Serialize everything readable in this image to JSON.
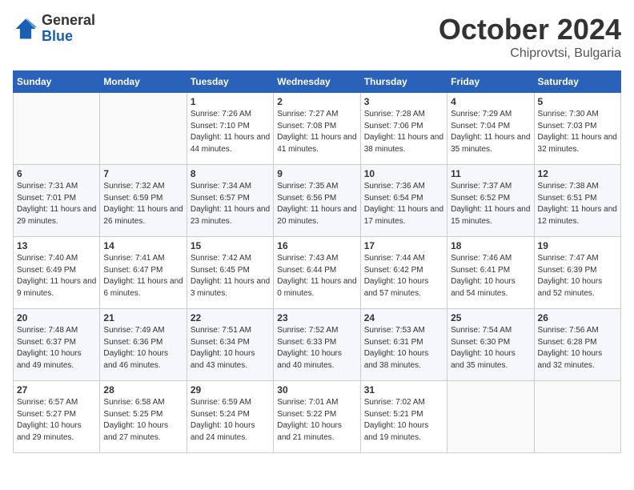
{
  "logo": {
    "general": "General",
    "blue": "Blue"
  },
  "header": {
    "month": "October 2024",
    "location": "Chiprovtsi, Bulgaria"
  },
  "weekdays": [
    "Sunday",
    "Monday",
    "Tuesday",
    "Wednesday",
    "Thursday",
    "Friday",
    "Saturday"
  ],
  "weeks": [
    [
      {
        "day": "",
        "info": ""
      },
      {
        "day": "",
        "info": ""
      },
      {
        "day": "1",
        "info": "Sunrise: 7:26 AM\nSunset: 7:10 PM\nDaylight: 11 hours and 44 minutes."
      },
      {
        "day": "2",
        "info": "Sunrise: 7:27 AM\nSunset: 7:08 PM\nDaylight: 11 hours and 41 minutes."
      },
      {
        "day": "3",
        "info": "Sunrise: 7:28 AM\nSunset: 7:06 PM\nDaylight: 11 hours and 38 minutes."
      },
      {
        "day": "4",
        "info": "Sunrise: 7:29 AM\nSunset: 7:04 PM\nDaylight: 11 hours and 35 minutes."
      },
      {
        "day": "5",
        "info": "Sunrise: 7:30 AM\nSunset: 7:03 PM\nDaylight: 11 hours and 32 minutes."
      }
    ],
    [
      {
        "day": "6",
        "info": "Sunrise: 7:31 AM\nSunset: 7:01 PM\nDaylight: 11 hours and 29 minutes."
      },
      {
        "day": "7",
        "info": "Sunrise: 7:32 AM\nSunset: 6:59 PM\nDaylight: 11 hours and 26 minutes."
      },
      {
        "day": "8",
        "info": "Sunrise: 7:34 AM\nSunset: 6:57 PM\nDaylight: 11 hours and 23 minutes."
      },
      {
        "day": "9",
        "info": "Sunrise: 7:35 AM\nSunset: 6:56 PM\nDaylight: 11 hours and 20 minutes."
      },
      {
        "day": "10",
        "info": "Sunrise: 7:36 AM\nSunset: 6:54 PM\nDaylight: 11 hours and 17 minutes."
      },
      {
        "day": "11",
        "info": "Sunrise: 7:37 AM\nSunset: 6:52 PM\nDaylight: 11 hours and 15 minutes."
      },
      {
        "day": "12",
        "info": "Sunrise: 7:38 AM\nSunset: 6:51 PM\nDaylight: 11 hours and 12 minutes."
      }
    ],
    [
      {
        "day": "13",
        "info": "Sunrise: 7:40 AM\nSunset: 6:49 PM\nDaylight: 11 hours and 9 minutes."
      },
      {
        "day": "14",
        "info": "Sunrise: 7:41 AM\nSunset: 6:47 PM\nDaylight: 11 hours and 6 minutes."
      },
      {
        "day": "15",
        "info": "Sunrise: 7:42 AM\nSunset: 6:45 PM\nDaylight: 11 hours and 3 minutes."
      },
      {
        "day": "16",
        "info": "Sunrise: 7:43 AM\nSunset: 6:44 PM\nDaylight: 11 hours and 0 minutes."
      },
      {
        "day": "17",
        "info": "Sunrise: 7:44 AM\nSunset: 6:42 PM\nDaylight: 10 hours and 57 minutes."
      },
      {
        "day": "18",
        "info": "Sunrise: 7:46 AM\nSunset: 6:41 PM\nDaylight: 10 hours and 54 minutes."
      },
      {
        "day": "19",
        "info": "Sunrise: 7:47 AM\nSunset: 6:39 PM\nDaylight: 10 hours and 52 minutes."
      }
    ],
    [
      {
        "day": "20",
        "info": "Sunrise: 7:48 AM\nSunset: 6:37 PM\nDaylight: 10 hours and 49 minutes."
      },
      {
        "day": "21",
        "info": "Sunrise: 7:49 AM\nSunset: 6:36 PM\nDaylight: 10 hours and 46 minutes."
      },
      {
        "day": "22",
        "info": "Sunrise: 7:51 AM\nSunset: 6:34 PM\nDaylight: 10 hours and 43 minutes."
      },
      {
        "day": "23",
        "info": "Sunrise: 7:52 AM\nSunset: 6:33 PM\nDaylight: 10 hours and 40 minutes."
      },
      {
        "day": "24",
        "info": "Sunrise: 7:53 AM\nSunset: 6:31 PM\nDaylight: 10 hours and 38 minutes."
      },
      {
        "day": "25",
        "info": "Sunrise: 7:54 AM\nSunset: 6:30 PM\nDaylight: 10 hours and 35 minutes."
      },
      {
        "day": "26",
        "info": "Sunrise: 7:56 AM\nSunset: 6:28 PM\nDaylight: 10 hours and 32 minutes."
      }
    ],
    [
      {
        "day": "27",
        "info": "Sunrise: 6:57 AM\nSunset: 5:27 PM\nDaylight: 10 hours and 29 minutes."
      },
      {
        "day": "28",
        "info": "Sunrise: 6:58 AM\nSunset: 5:25 PM\nDaylight: 10 hours and 27 minutes."
      },
      {
        "day": "29",
        "info": "Sunrise: 6:59 AM\nSunset: 5:24 PM\nDaylight: 10 hours and 24 minutes."
      },
      {
        "day": "30",
        "info": "Sunrise: 7:01 AM\nSunset: 5:22 PM\nDaylight: 10 hours and 21 minutes."
      },
      {
        "day": "31",
        "info": "Sunrise: 7:02 AM\nSunset: 5:21 PM\nDaylight: 10 hours and 19 minutes."
      },
      {
        "day": "",
        "info": ""
      },
      {
        "day": "",
        "info": ""
      }
    ]
  ]
}
